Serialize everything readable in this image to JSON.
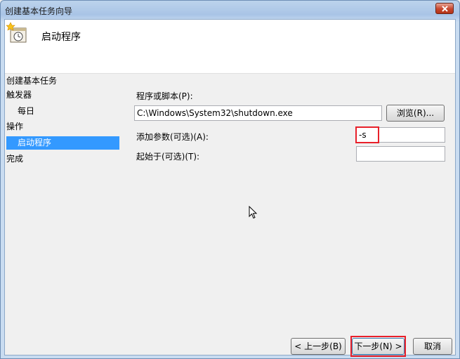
{
  "window": {
    "title": "创建基本任务向导"
  },
  "header": {
    "title": "启动程序",
    "icon": "task-clock-icon"
  },
  "nav": {
    "items": [
      {
        "label": "创建基本任务",
        "selected": false
      },
      {
        "label": "触发器",
        "selected": false
      },
      {
        "label": "每日",
        "selected": false
      },
      {
        "label": "操作",
        "selected": false
      },
      {
        "label": "启动程序",
        "selected": true
      },
      {
        "label": "完成",
        "selected": false
      }
    ]
  },
  "form": {
    "program_label": "程序或脚本(P):",
    "program_value": "C:\\Windows\\System32\\shutdown.exe",
    "browse_label": "浏览(R)...",
    "args_label": "添加参数(可选)(A):",
    "args_value": "-s",
    "start_in_label": "起始于(可选)(T):",
    "start_in_value": ""
  },
  "footer": {
    "back_label": "< 上一步(B)",
    "next_label": "下一步(N) >",
    "cancel_label": "取消"
  },
  "colors": {
    "selection": "#3399ff",
    "highlight": "#e8202a"
  }
}
